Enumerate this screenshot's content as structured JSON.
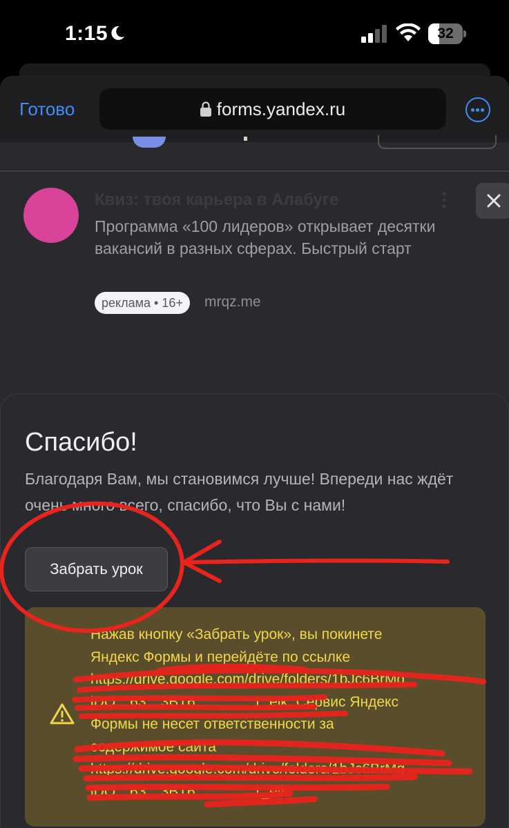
{
  "status_bar": {
    "time": "1:15",
    "battery": "32",
    "battery_level": 0.32
  },
  "browser": {
    "done_label": "Готово",
    "url": "forms.yandex.ru"
  },
  "ad": {
    "title": "Квиз: твоя карьера в Алабуге",
    "text": "Программа «100 лидеров» открывает десятки вакансий в разных сферах. Быстрый старт",
    "badge": "реклама • 16+",
    "domain": "mrqz.me"
  },
  "form": {
    "title": "Спасибо!",
    "description": "Благодаря Вам, мы становимся лучше! Впереди нас ждёт очень много всего, спасибо, что Вы с нами!",
    "button_label": "Забрать урок",
    "warning_lines": [
      "Нажав кнопку «Забрать урок», вы покинете",
      "Яндекс Формы и перейдёте по ссылке",
      "https://drive.google.com/drive/folders/1bJc6BrMg",
      "iDQ…63…3BT6…………1_eik. Сервис Яндекс",
      "Формы не несет ответственности за",
      "содержимое сайта",
      "https://drive.google.com/drive/folders/1bJc6BrMg",
      "iDQ…63…3BT6…………1_eik"
    ]
  },
  "colors": {
    "accent_blue": "#3f8ef5",
    "warning_text": "#f1d84a",
    "warning_bg": "#5a4d2c",
    "annotation_red": "#e8241c"
  }
}
